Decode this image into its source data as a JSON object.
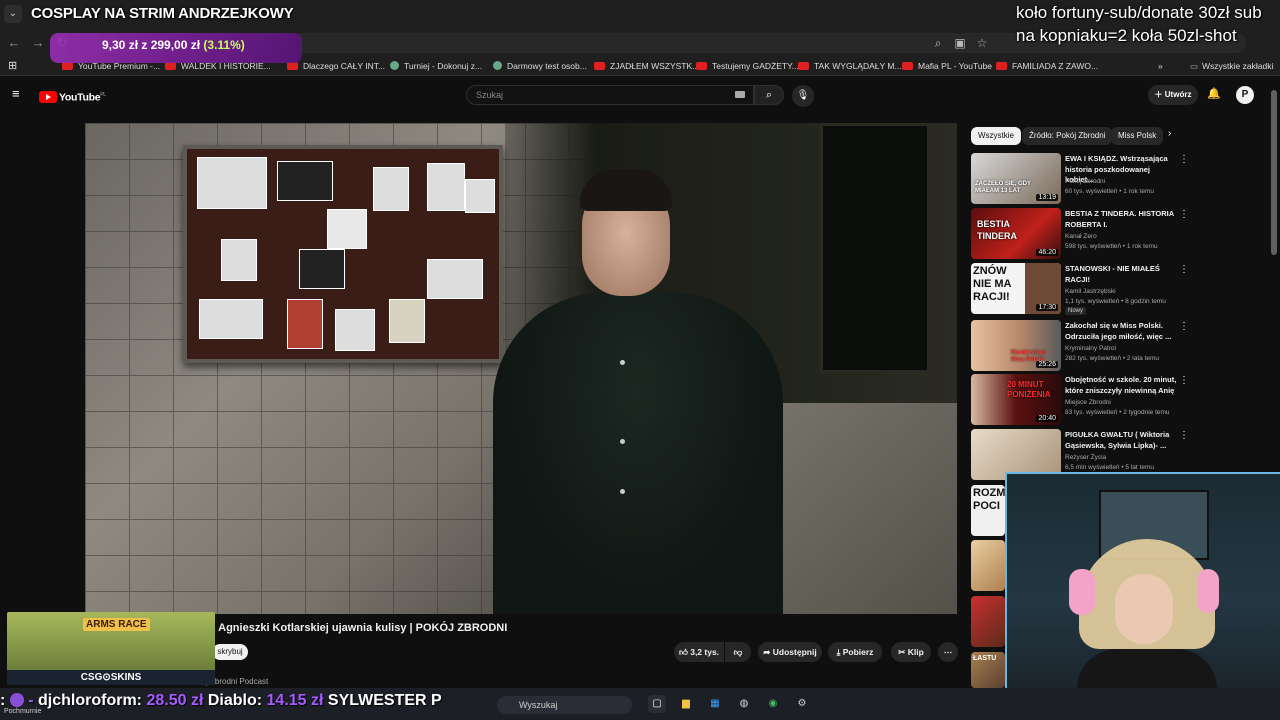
{
  "overlay": {
    "stream_title": "COSPLAY NA STRIM ANDRZEJKOWY",
    "goal_amount": "9,30 zł z 299,00 zł",
    "goal_pct": "(3.11%)",
    "goal_progress": 0.0311,
    "donate_info": "koło fortuny-sub/donate 30zł sub na kopniaku=2 koła 50zl-shot",
    "ticker_prefix": ":",
    "ticker_amount_1": "-",
    "ticker_name_2": "djchloroform:",
    "ticker_amount_2": "28.50 zł",
    "ticker_name_3": "Diablo:",
    "ticker_amount_3": "14.15 zł",
    "ticker_name_4": "SYLWESTER P",
    "ad_title": "ARMS RACE",
    "ad_brand": "CSG⊙SKINS"
  },
  "browser": {
    "bookmarks": [
      {
        "label": "YouTube Premium -...",
        "icon": "yt"
      },
      {
        "label": "WALDEK I HISTORIE...",
        "icon": "yt"
      },
      {
        "label": "Dlaczego CAŁY INT...",
        "icon": "yt"
      },
      {
        "label": "Turniej - Dokonuj z...",
        "icon": "gen"
      },
      {
        "label": "Darmowy test osob...",
        "icon": "gen"
      },
      {
        "label": "ZJADŁEM WSZYSTK...",
        "icon": "yt"
      },
      {
        "label": "Testujemy GADŻETY...",
        "icon": "yt"
      },
      {
        "label": "TAK WYGLĄDAŁY M...",
        "icon": "yt"
      },
      {
        "label": "Mafia PL - YouTube",
        "icon": "yt"
      },
      {
        "label": "FAMILIADA Z ZAWO...",
        "icon": "yt"
      }
    ],
    "all_bookmarks": "Wszystkie zakładki"
  },
  "youtube": {
    "logo": "YouTube",
    "logo_region": "PL",
    "search_placeholder": "Szukaj",
    "create_label": "Utwórz",
    "video_title": "ż Agnieszki Kotlarskiej ujawnia kulisy | POKÓJ ZBRODNI",
    "subscribe_label": "skrybuj",
    "channel_partial": "j Zbrodni Podcast",
    "likes": "3,2 tys.",
    "share_label": "Udostępnij",
    "download_label": "Pobierz",
    "clip_label": "Klip",
    "chips": [
      "Wszystkie",
      "Źródło: Pokój Zbrodni",
      "Miss Polsk"
    ],
    "recommendations": [
      {
        "title": "EWA I KSIĄDZ. Wstrząsająca historia poszkodowanej kobiet...",
        "channel": "Pokój Zbrodni",
        "meta": "60 tys. wyświetleń • 1 rok temu",
        "duration": "13:19",
        "thumb_text": "ZACZĘŁO SIĘ, GDY MIAŁAM 13 LAT",
        "badge": ""
      },
      {
        "title": "BESTIA Z TINDERA. HISTORIA ROBERTA I.",
        "channel": "Kanał Zero",
        "meta": "598 tys. wyświetleń • 1 rok temu",
        "duration": "46:20",
        "thumb_text": "BESTIA TINDERA",
        "badge": ""
      },
      {
        "title": "STANOWSKI - NIE MIAŁEŚ RACJI!",
        "channel": "Kamil Jastrzębski",
        "meta": "1,1 tys. wyświetleń • 8 godzin temu",
        "duration": "17:30",
        "thumb_text": "ZNÓW NIE MA RACJI!",
        "badge": "Nowy"
      },
      {
        "title": "Zakochał się w Miss Polski. Odrzuciła jego miłość, więc ...",
        "channel": "Kryminalny Patrol",
        "meta": "282 tys. wyświetleń • 2 lata temu",
        "duration": "25:26",
        "thumb_text": "Morderstwo Miss Polski",
        "badge": ""
      },
      {
        "title": "Obojętność w szkole. 20 minut, które zniszczyły niewinną Anię",
        "channel": "Miejsce Zbrodni",
        "meta": "83 tys. wyświetleń • 2 tygodnie temu",
        "duration": "20:40",
        "thumb_text": "20 MINUT PONIŻENIA",
        "badge": ""
      },
      {
        "title": "PIGUŁKA GWAŁTU ( Wiktoria Gąsiewska, Sylwia Lipka)- ...",
        "channel": "Reżyser Życia",
        "meta": "6,5 mln wyświetleń • 5 lat temu",
        "duration": "",
        "thumb_text": "",
        "badge": ""
      }
    ],
    "partial_thumbs": [
      "ROZM POCI",
      "",
      "",
      "ŁASTU"
    ]
  },
  "taskbar": {
    "weather": "Pochmurnie",
    "search_label": "Wyszukaj"
  },
  "colors": {
    "accent_red": "#ff0000",
    "goal_purple": "#9c2fb8",
    "ticker_amount": "#a55bff"
  }
}
